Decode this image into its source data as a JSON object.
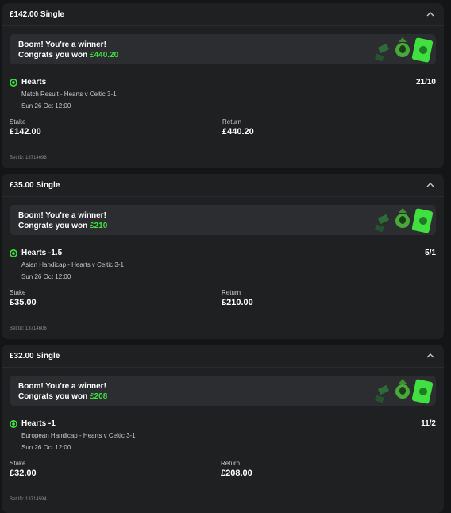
{
  "colors": {
    "background": "#141516",
    "card": "#1f2022",
    "accent_green": "#3fe03f"
  },
  "icons": [
    "chevron-up-icon",
    "check-circle-icon",
    "money-mascot-art"
  ],
  "bets": [
    {
      "title": "£142.00 Single",
      "banner_line1": "Boom! You're a winner!",
      "banner_congrats": "Congrats you won",
      "banner_amount": "£440.20",
      "selection": "Hearts",
      "odds": "21/10",
      "market": "Match Result - Hearts v Celtic 3-1",
      "time": "Sun 26 Oct 12:00",
      "stake_label": "Stake",
      "stake": "£142.00",
      "return_label": "Return",
      "return": "£440.20",
      "bet_id": "Bet ID: 13714698"
    },
    {
      "title": "£35.00 Single",
      "banner_line1": "Boom! You're a winner!",
      "banner_congrats": "Congrats you won",
      "banner_amount": "£210",
      "selection": "Hearts -1.5",
      "odds": "5/1",
      "market": "Asian Handicap - Hearts v Celtic 3-1",
      "time": "Sun 26 Oct 12:00",
      "stake_label": "Stake",
      "stake": "£35.00",
      "return_label": "Return",
      "return": "£210.00",
      "bet_id": "Bet ID: 13714606"
    },
    {
      "title": "£32.00 Single",
      "banner_line1": "Boom! You're a winner!",
      "banner_congrats": "Congrats you won",
      "banner_amount": "£208",
      "selection": "Hearts -1",
      "odds": "11/2",
      "market": "European Handicap - Hearts v Celtic 3-1",
      "time": "Sun 26 Oct 12:00",
      "stake_label": "Stake",
      "stake": "£32.00",
      "return_label": "Return",
      "return": "£208.00",
      "bet_id": "Bet ID: 13714594"
    }
  ]
}
